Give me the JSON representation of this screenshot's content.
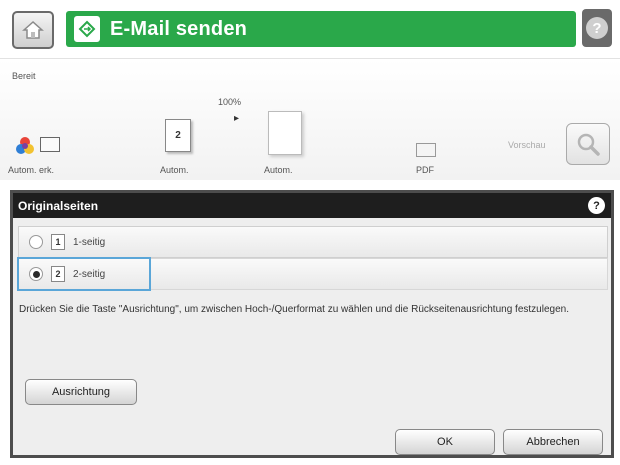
{
  "header": {
    "title": "E-Mail senden",
    "icons": {
      "home": "home-icon",
      "app": "email-diamond-icon",
      "help": "help-icon"
    },
    "colors": {
      "title_bar": "#2aa84a",
      "help_bg": "#6a6a6a"
    }
  },
  "status": {
    "text": "Bereit"
  },
  "settings": {
    "zoom": "100%",
    "color_mode_label": "Autom. erk.",
    "sides_label": "Autom.",
    "sides_icon_number": "2",
    "original_size_label": "Autom.",
    "file_type_label": "PDF",
    "preview_label": "Vorschau"
  },
  "dialog": {
    "title": "Originalseiten",
    "options": [
      {
        "number": "1",
        "label": "1-seitig",
        "selected": false
      },
      {
        "number": "2",
        "label": "2-seitig",
        "selected": true
      }
    ],
    "description": "Drücken Sie die Taste \"Ausrichtung\", um zwischen Hoch-/Querformat zu wählen und die Rückseitenausrichtung festzulegen.",
    "orientation_button": "Ausrichtung",
    "ok_button": "OK",
    "cancel_button": "Abbrechen",
    "colors": {
      "header": "#1e1e1e",
      "selection_outline": "#5aa6d8"
    }
  }
}
